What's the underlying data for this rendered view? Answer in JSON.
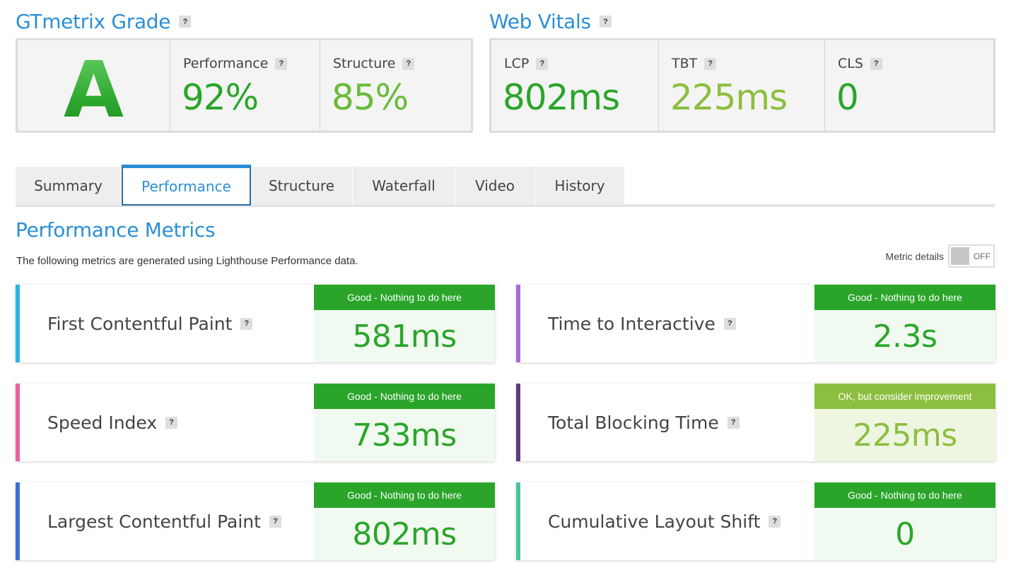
{
  "grade_section": {
    "title": "GTmetrix Grade",
    "grade": "A",
    "performance_label": "Performance",
    "performance_value": "92%",
    "structure_label": "Structure",
    "structure_value": "85%"
  },
  "vitals_section": {
    "title": "Web Vitals",
    "lcp_label": "LCP",
    "lcp_value": "802ms",
    "tbt_label": "TBT",
    "tbt_value": "225ms",
    "cls_label": "CLS",
    "cls_value": "0"
  },
  "help_glyph": "?",
  "tabs": [
    "Summary",
    "Performance",
    "Structure",
    "Waterfall",
    "Video",
    "History"
  ],
  "active_tab": "Performance",
  "metrics_section": {
    "title": "Performance Metrics",
    "description": "The following metrics are generated using Lighthouse Performance data.",
    "toggle_label": "Metric details",
    "toggle_state": "OFF"
  },
  "metrics": [
    {
      "name": "First Contentful Paint",
      "status": "Good - Nothing to do here",
      "value": "581ms",
      "accent": "#29b5e8",
      "rating": "good"
    },
    {
      "name": "Time to Interactive",
      "status": "Good - Nothing to do here",
      "value": "2.3s",
      "accent": "#a86ed4",
      "rating": "good"
    },
    {
      "name": "Speed Index",
      "status": "Good - Nothing to do here",
      "value": "733ms",
      "accent": "#e9619d",
      "rating": "good"
    },
    {
      "name": "Total Blocking Time",
      "status": "OK, but consider improvement",
      "value": "225ms",
      "accent": "#5e3c7c",
      "rating": "ok"
    },
    {
      "name": "Largest Contentful Paint",
      "status": "Good - Nothing to do here",
      "value": "802ms",
      "accent": "#3b6fd4",
      "rating": "good"
    },
    {
      "name": "Cumulative Layout Shift",
      "status": "Good - Nothing to do here",
      "value": "0",
      "accent": "#4cc4a3",
      "rating": "good"
    }
  ],
  "colors": {
    "title_blue": "#2b8fd6",
    "good_green": "#2aa52a",
    "good_bg": "#f1faf0",
    "ok_green": "#8cbf3f",
    "ok_bg": "#eef5e1"
  }
}
